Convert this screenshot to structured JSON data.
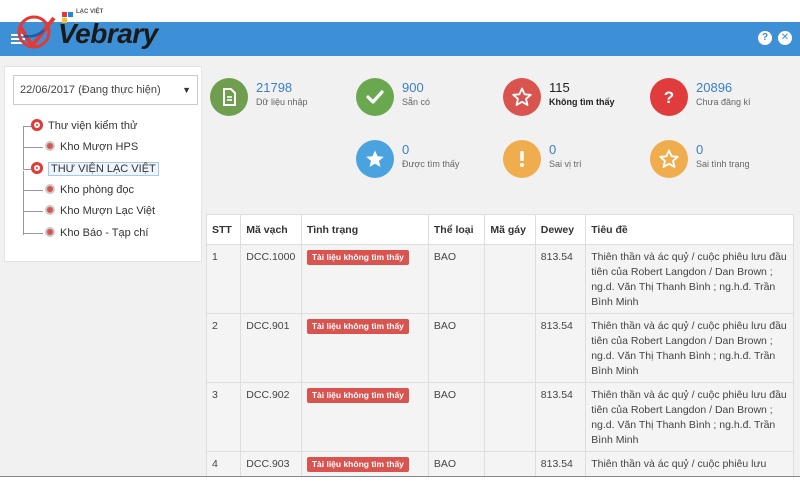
{
  "app": {
    "logo_text": "Vebrary",
    "logo_small": "LẠC VIỆT"
  },
  "header": {
    "help_icon": "question-icon",
    "close_icon": "close-icon",
    "help_label": "?",
    "close_label": "✕"
  },
  "sidebar": {
    "date_select": "22/06/2017 (Đang thực hiện)",
    "tree": [
      {
        "label": "Thư viện kiểm thử",
        "level": 0,
        "icon": "library-root-icon"
      },
      {
        "label": "Kho Mượn HPS",
        "level": 1,
        "icon": "storage-icon"
      },
      {
        "label": "THƯ VIỆN LẠC VIỆT",
        "level": 0,
        "icon": "library-root-icon",
        "selected": true
      },
      {
        "label": "Kho phòng đọc",
        "level": 1,
        "icon": "storage-icon"
      },
      {
        "label": "Kho Mượn Lạc Việt",
        "level": 1,
        "icon": "storage-icon"
      },
      {
        "label": "Kho Báo - Tạp chí",
        "level": 1,
        "icon": "storage-icon"
      }
    ]
  },
  "stats": [
    {
      "value": "21798",
      "label": "Dữ liệu nhập",
      "color": "#6f9e4f",
      "icon": "document-icon"
    },
    {
      "value": "900",
      "label": "Sẵn có",
      "color": "#6aa84f",
      "icon": "check-icon"
    },
    {
      "value": "115",
      "label": "Không tìm thấy",
      "color": "#d9534f",
      "icon": "star-outline-icon"
    },
    {
      "value": "20896",
      "label": "Chưa đăng kí",
      "color": "#e03c3c",
      "icon": "question-icon"
    },
    {
      "value": "0",
      "label": "Được tìm thấy",
      "color": "#4aa3df",
      "icon": "star-icon"
    },
    {
      "value": "0",
      "label": "Sai vị trí",
      "color": "#f0ad4e",
      "icon": "exclamation-icon"
    },
    {
      "value": "0",
      "label": "Sai tình trạng",
      "color": "#f0ad4e",
      "icon": "star-outline-icon"
    }
  ],
  "table": {
    "headers": [
      "STT",
      "Mã vạch",
      "Tình trạng",
      "Thể loại",
      "Mã gáy",
      "Dewey",
      "Tiêu đề"
    ],
    "rows": [
      {
        "stt": "1",
        "barcode": "DCC.1000",
        "status": "Tài liệu không tìm thấy",
        "type": "BAO",
        "spine": "",
        "dewey": "813.54",
        "title": "Thiên thần và ác quỷ / cuộc phiêu lưu đầu tiên của Robert Langdon / Dan Brown ; ng.d. Văn Thị Thanh Bình ; ng.h.đ. Trần Bình Minh"
      },
      {
        "stt": "2",
        "barcode": "DCC.901",
        "status": "Tài liệu không tìm thấy",
        "type": "BAO",
        "spine": "",
        "dewey": "813.54",
        "title": "Thiên thần và ác quỷ / cuộc phiêu lưu đầu tiên của Robert Langdon / Dan Brown ; ng.d. Văn Thị Thanh Bình ; ng.h.đ. Trần Bình Minh"
      },
      {
        "stt": "3",
        "barcode": "DCC.902",
        "status": "Tài liệu không tìm thấy",
        "type": "BAO",
        "spine": "",
        "dewey": "813.54",
        "title": "Thiên thần và ác quỷ / cuộc phiêu lưu đầu tiên của Robert Langdon / Dan Brown ; ng.d. Văn Thị Thanh Bình ; ng.h.đ. Trần Bình Minh"
      },
      {
        "stt": "4",
        "barcode": "DCC.903",
        "status": "Tài liệu không tìm thấy",
        "type": "BAO",
        "spine": "",
        "dewey": "813.54",
        "title": "Thiên thần và ác quỷ / cuộc phiêu lưu"
      }
    ]
  },
  "colors": {
    "header_blue": "#3d8fd6",
    "badge_red": "#d9534f",
    "number_blue": "#3a7fc4"
  }
}
